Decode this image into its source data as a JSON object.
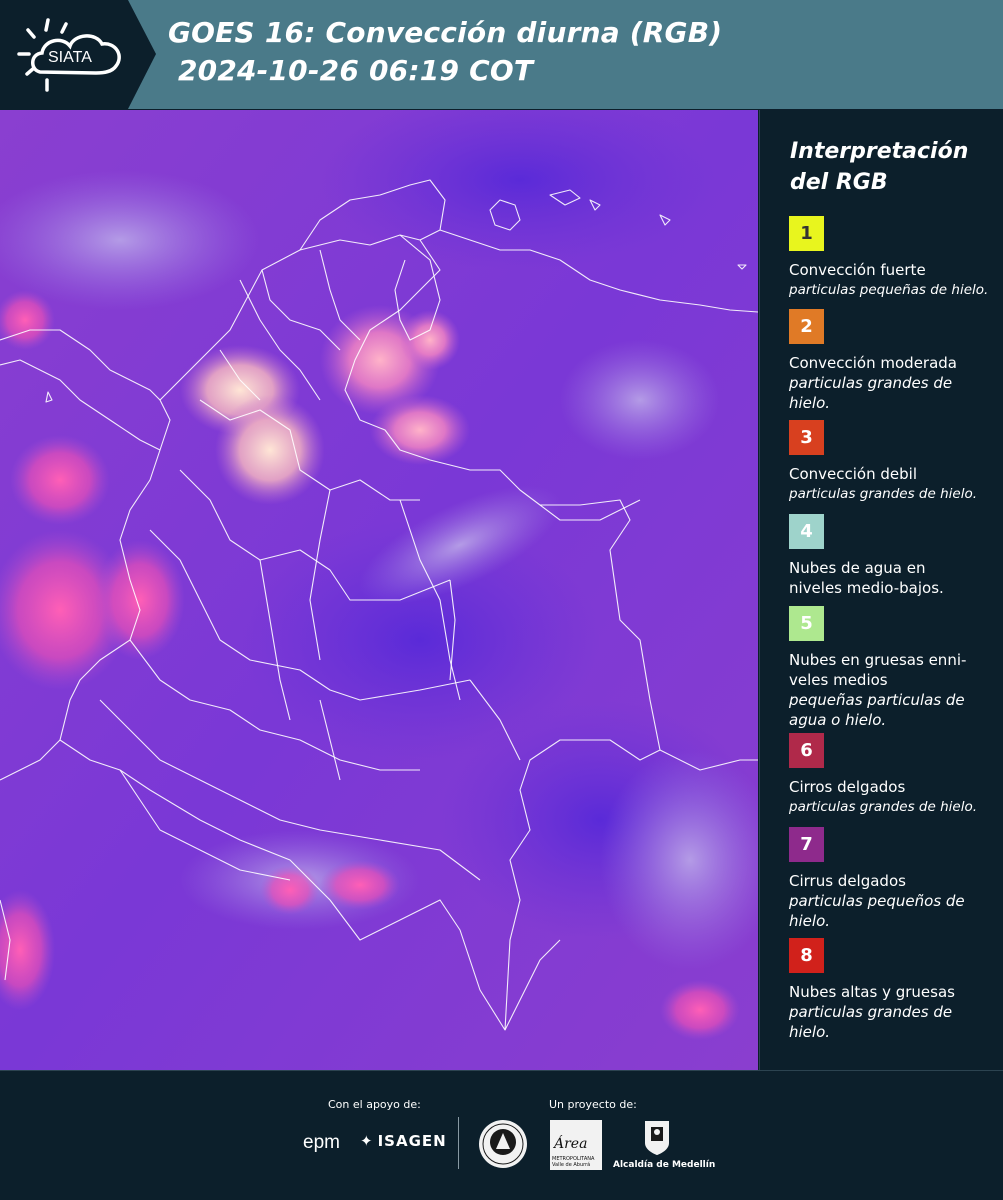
{
  "header": {
    "logo_text": "SIATA",
    "title": "GOES 16: Convección diurna (RGB)\n 2024-10-26 06:19 COT"
  },
  "legend": {
    "title": "Interpretación del RGB",
    "items": [
      {
        "number": "1",
        "color": "#e8f51e",
        "text_color": "#333333",
        "title": "Convección fuerte",
        "subtitle": "particulas pequeñas de hielo."
      },
      {
        "number": "2",
        "color": "#e07a26",
        "text_color": "#ffffff",
        "title": "Convección moderada",
        "subtitle": "particulas grandes de hielo."
      },
      {
        "number": "3",
        "color": "#d8401f",
        "text_color": "#ffffff",
        "title": "Convección debil",
        "subtitle": "particulas grandes de hielo."
      },
      {
        "number": "4",
        "color": "#9ed3cb",
        "text_color": "#ffffff",
        "title": "Nubes de agua en niveles medio-bajos.",
        "subtitle": ""
      },
      {
        "number": "5",
        "color": "#aee88f",
        "text_color": "#ffffff",
        "title": "Nubes en gruesas enni-veles medios",
        "subtitle": "pequeñas particulas de agua o hielo."
      },
      {
        "number": "6",
        "color": "#b0294a",
        "text_color": "#ffffff",
        "title": "Cirros delgados",
        "subtitle": "particulas grandes de hielo."
      },
      {
        "number": "7",
        "color": "#8e2a8c",
        "text_color": "#ffffff",
        "title": "Cirrus delgados",
        "subtitle": "particulas pequeños de hielo."
      },
      {
        "number": "8",
        "color": "#d1211b",
        "text_color": "#ffffff",
        "title": "Nubes altas y gruesas",
        "subtitle": "particulas grandes de hielo."
      }
    ]
  },
  "footer": {
    "support_label": "Con el apoyo de:",
    "project_label": "Un proyecto de:",
    "epm": "epm",
    "isagen": "ISAGEN",
    "area_name": "Área",
    "area_sub": "METROPOLITANA Valle de Aburrá",
    "alcaldia": "Alcaldía de Medellín"
  }
}
